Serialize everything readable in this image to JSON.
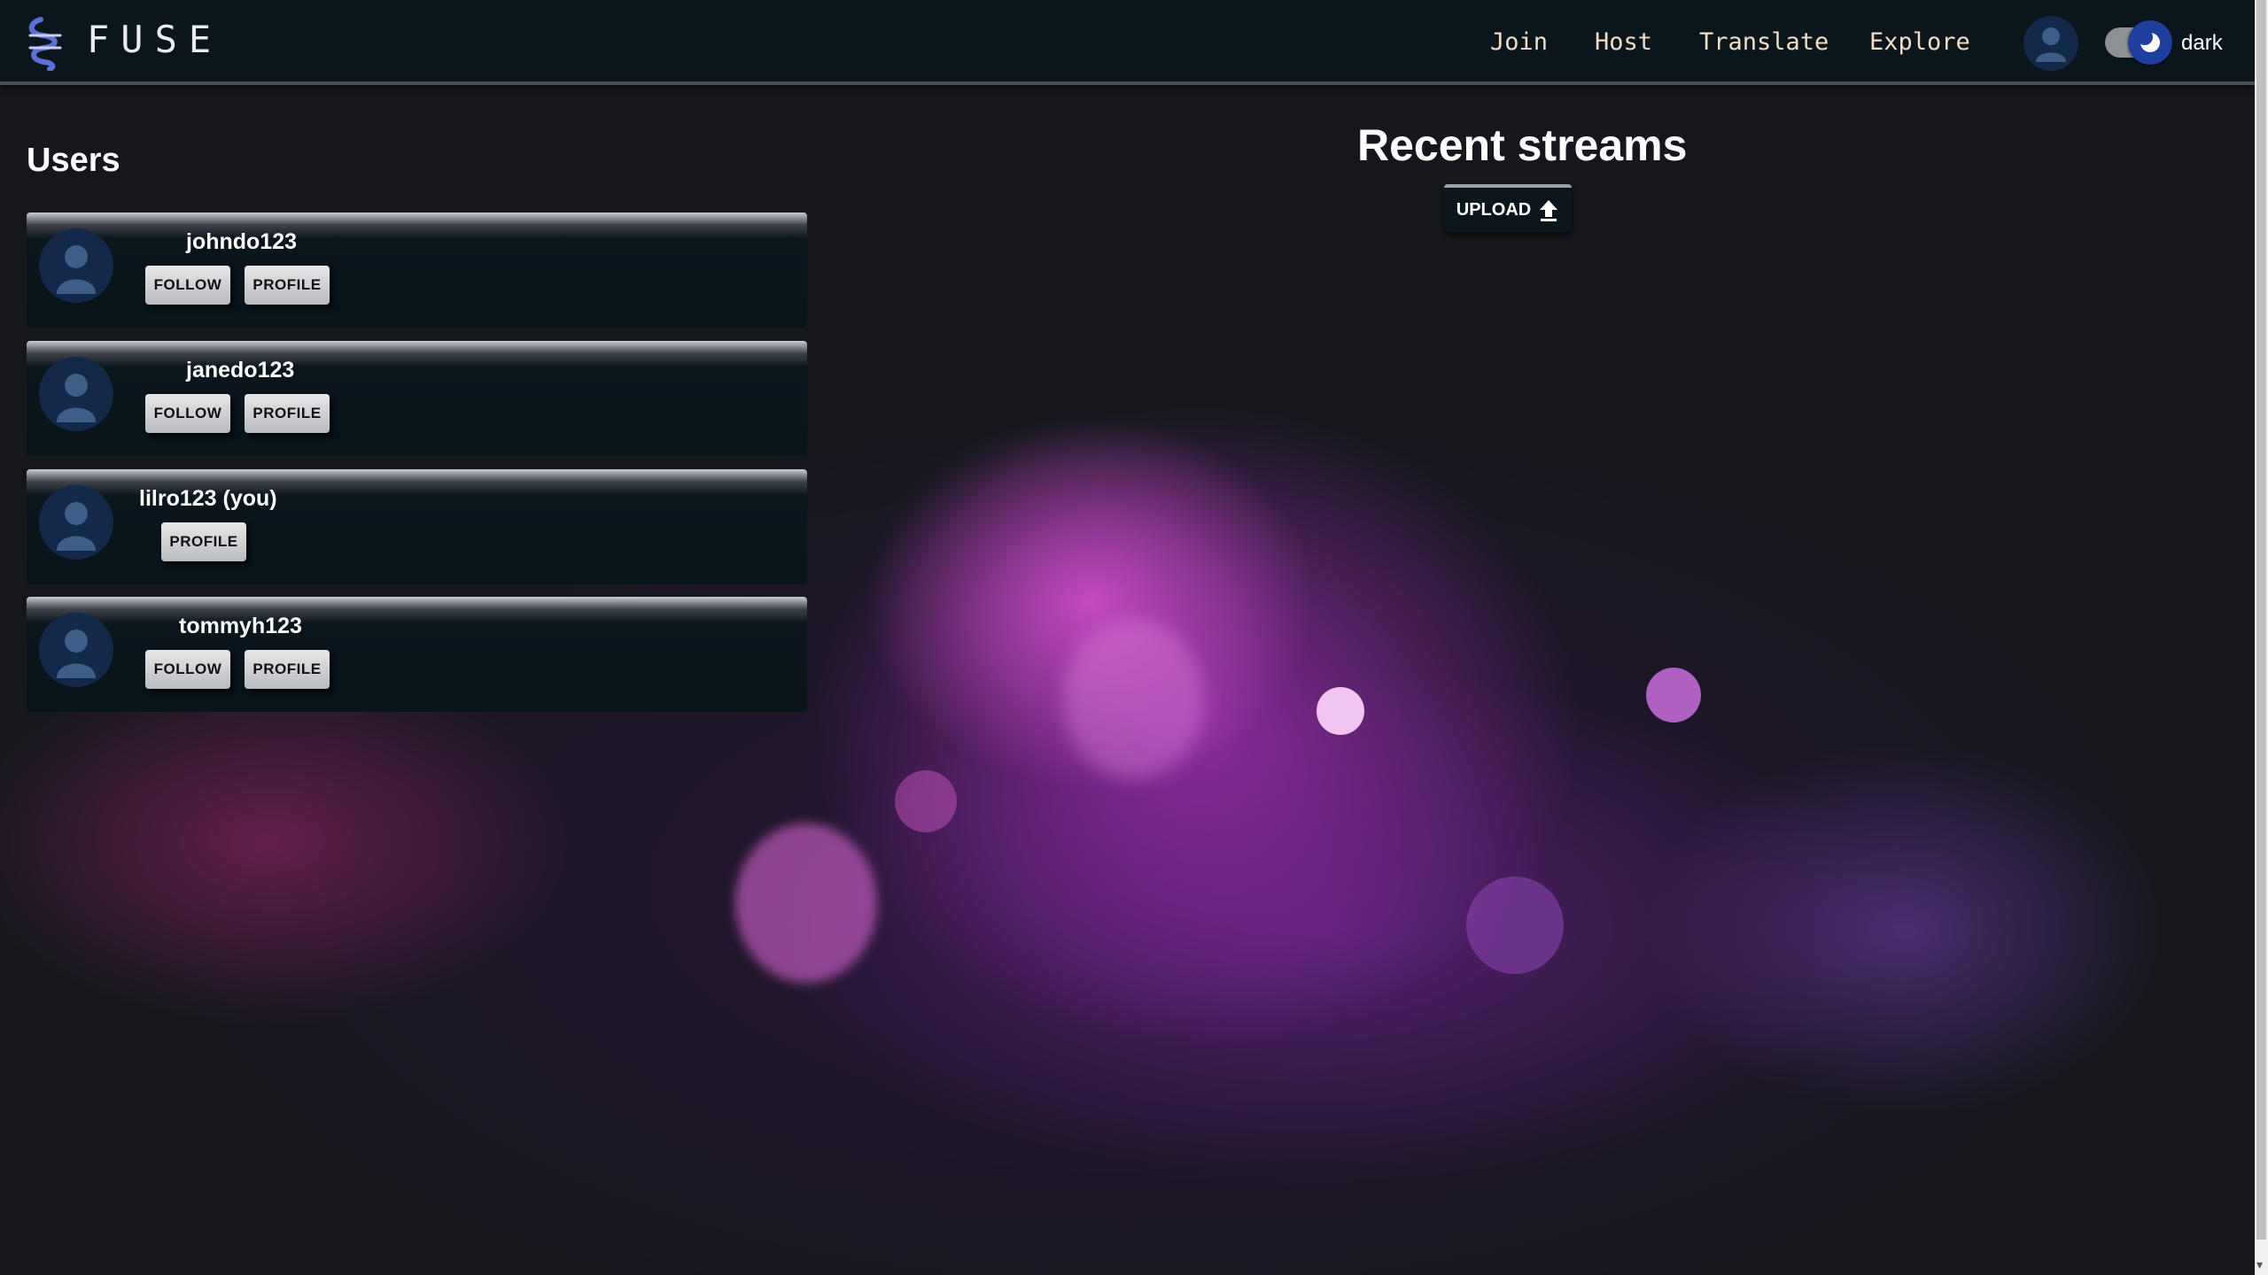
{
  "header": {
    "brand": "FUSE",
    "nav": [
      "Join",
      "Host",
      "Translate",
      "Explore"
    ],
    "theme_label": "dark",
    "logo_icon": "fuse-logo-icon"
  },
  "users": {
    "title": "Users",
    "list": [
      {
        "name": "johndo123",
        "follow_label": "FOLLOW",
        "profile_label": "PROFILE"
      },
      {
        "name": "janedo123",
        "follow_label": "FOLLOW",
        "profile_label": "PROFILE"
      },
      {
        "name": "lilro123 (you)",
        "profile_label": "PROFILE"
      },
      {
        "name": "tommyh123",
        "follow_label": "FOLLOW",
        "profile_label": "PROFILE"
      }
    ]
  },
  "streams": {
    "title": "Recent streams",
    "upload_label": "UPLOAD",
    "upload_icon": "upload-arrow-icon"
  },
  "colors": {
    "topbar": "#0b151c",
    "nav_text": "#f3dcc4",
    "toggle_knob": "#1d3f9e",
    "background": "#15171d",
    "accent_pink": "#d750d2"
  }
}
